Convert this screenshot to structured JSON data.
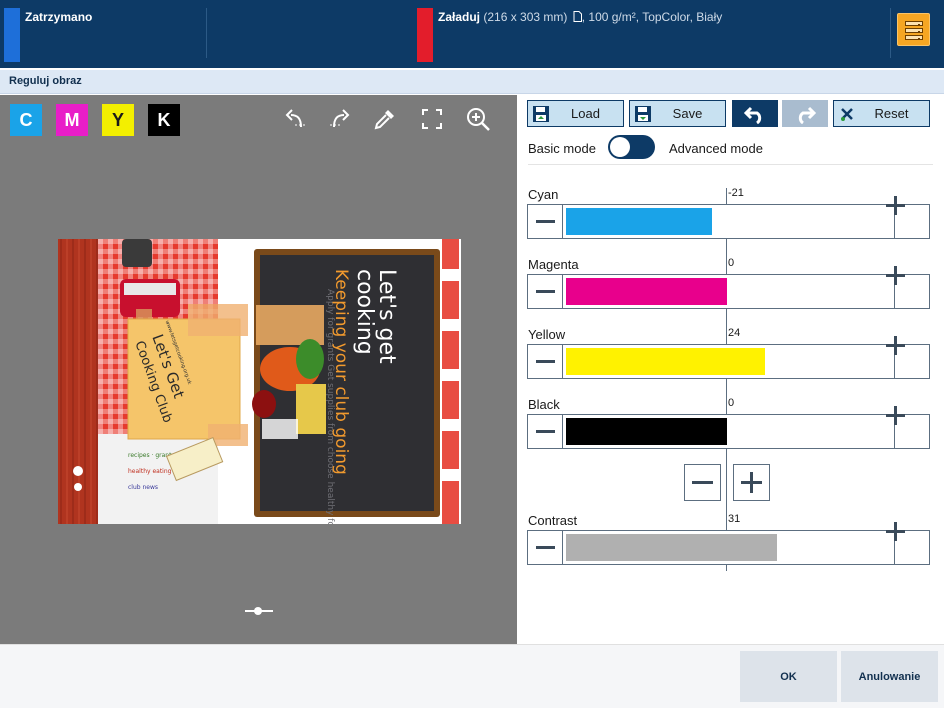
{
  "status_bar": {
    "segment_1": {
      "label": "Zatrzymano",
      "accent_color": "#1e6fd9"
    },
    "segment_2": {
      "label": "Załaduj",
      "size": "(216 x 303 mm)",
      "details": ", 100 g/m², TopColor, Biały",
      "accent_color": "#e31d2b"
    },
    "menu_icon": "server-stack-icon"
  },
  "dialog_title": "Reguluj obraz",
  "preview": {
    "channels": [
      {
        "label": "C",
        "bg": "#1aa3e8",
        "fg": "#ffffff"
      },
      {
        "label": "M",
        "bg": "#e81ec8",
        "fg": "#ffffff"
      },
      {
        "label": "Y",
        "bg": "#f3ef00",
        "fg": "#1a1a1a"
      },
      {
        "label": "K",
        "bg": "#000000",
        "fg": "#ffffff"
      }
    ],
    "tools": [
      "rotate-left-icon",
      "rotate-right-icon",
      "eyedropper-icon",
      "fit-screen-icon",
      "zoom-in-icon"
    ],
    "document": {
      "title_line_1": "Let's get",
      "title_line_2": "cooking",
      "subtitle": "Keeping your club going",
      "chalk_text": "Apply for grants\nGet supplies from\nchoose healthy food",
      "note_line_1": "Let's Get",
      "note_line_2": "Cooking Club",
      "note_small": "www.letsgetcooking.org.uk"
    }
  },
  "panel": {
    "load_label": "Load",
    "save_label": "Save",
    "reset_label": "Reset",
    "basic_mode": "Basic mode",
    "advanced_mode": "Advanced mode",
    "sliders": [
      {
        "name": "Cyan",
        "value": "-21",
        "level": -21,
        "color": "#1aa3e8"
      },
      {
        "name": "Magenta",
        "value": "0",
        "level": 0,
        "color": "#e8008c"
      },
      {
        "name": "Yellow",
        "value": "24",
        "level": 24,
        "color": "#fff200"
      },
      {
        "name": "Black",
        "value": "0",
        "level": 0,
        "color": "#000000"
      }
    ],
    "contrast": {
      "name": "Contrast",
      "value": "31",
      "level": 31,
      "color": "#b0b0b0"
    }
  },
  "footer": {
    "ok_label": "OK",
    "cancel_label": "Anulowanie"
  }
}
